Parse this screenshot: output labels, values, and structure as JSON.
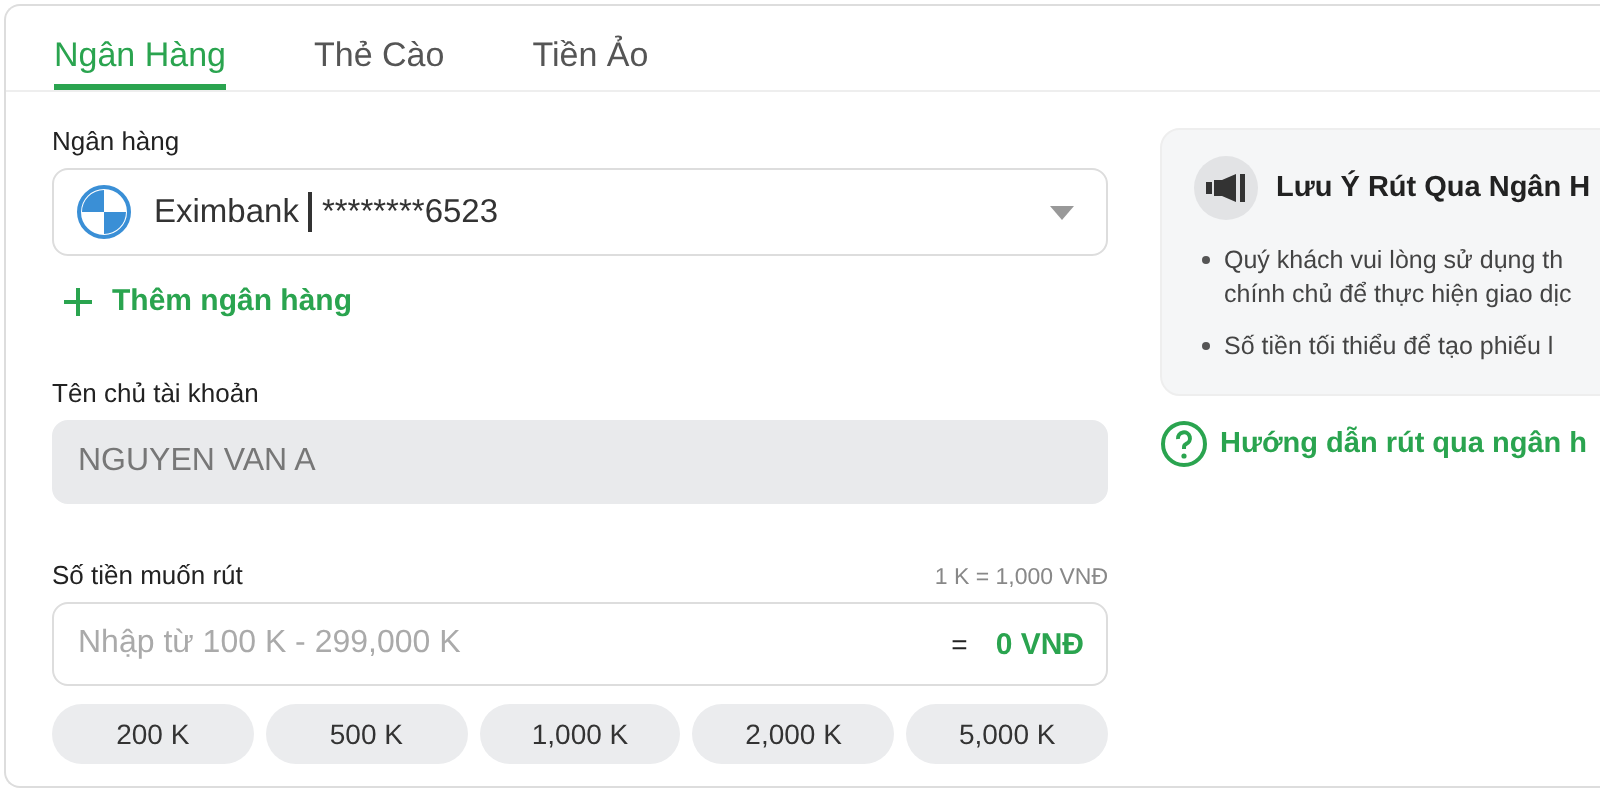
{
  "tabs": [
    {
      "label": "Ngân Hàng",
      "selected": true
    },
    {
      "label": "Thẻ Cào",
      "selected": false
    },
    {
      "label": "Tiền Ảo",
      "selected": false
    }
  ],
  "bank": {
    "label": "Ngân hàng",
    "value": "Eximbank",
    "account": "********6523",
    "add_link": "Thêm ngân hàng"
  },
  "holder": {
    "label": "Tên chủ tài khoản",
    "value": "NGUYEN VAN A",
    "disabled": true
  },
  "amount": {
    "label": "Số tiền muốn rút",
    "rate": "1 K = 1,000 VNĐ",
    "placeholder": "Nhập từ 100 K - 299,000 K",
    "equals": "=",
    "result": "0 VNĐ"
  },
  "presets": [
    "200 K",
    "500 K",
    "1,000 K",
    "2,000 K",
    "5,000 K"
  ],
  "notice": {
    "title": "Lưu Ý Rút Qua Ngân H",
    "bullets": [
      {
        "lines": [
          "Quý khách vui lòng sử dụng th",
          "chính chủ để thực hiện giao dịc"
        ]
      },
      {
        "lines": [
          "Số tiền tối thiểu để tạo phiếu l"
        ]
      }
    ]
  },
  "guide_link": "Hướng dẫn rút qua ngân h"
}
